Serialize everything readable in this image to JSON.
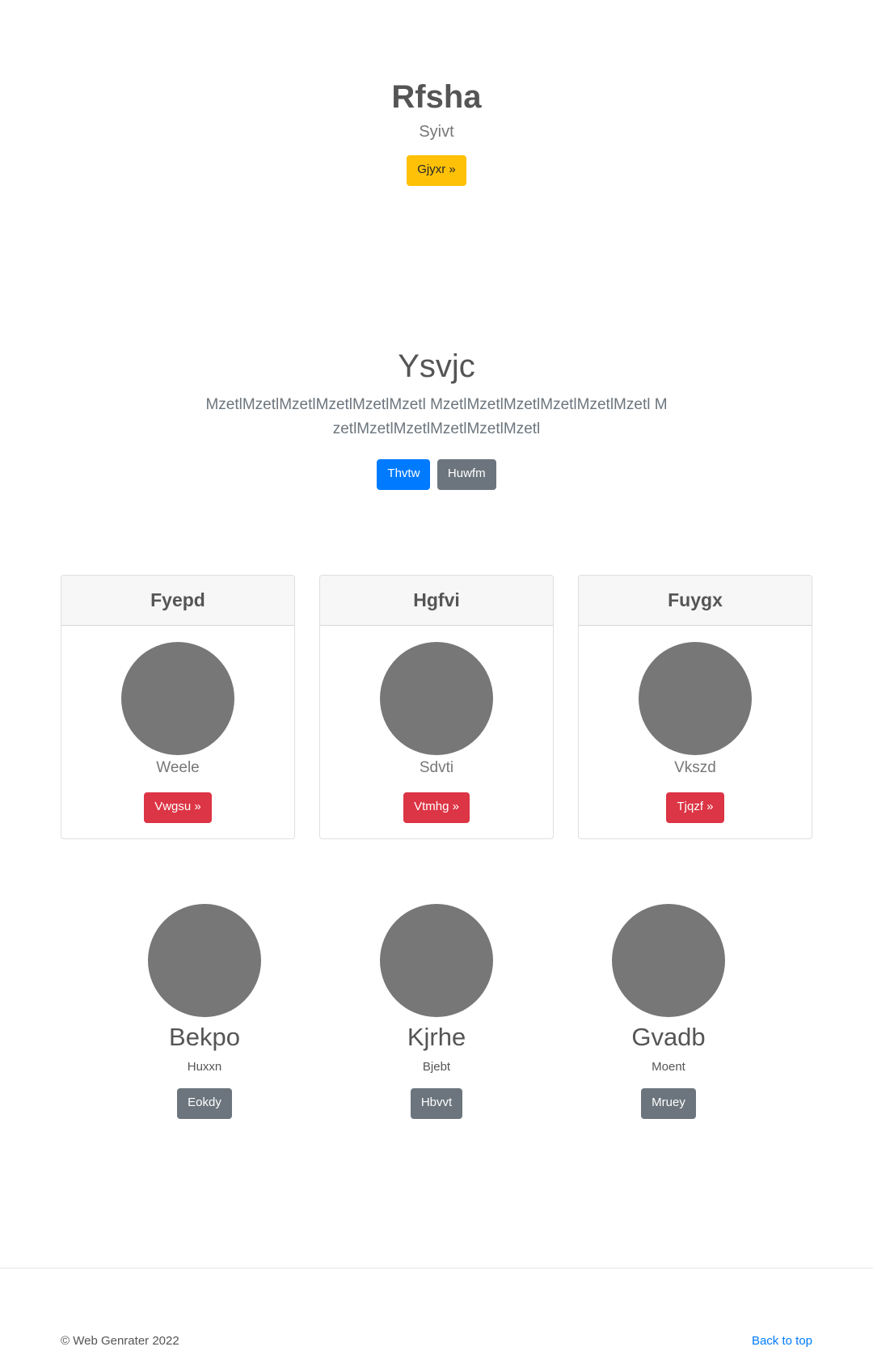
{
  "hero": {
    "title": "Rfsha",
    "subtitle": "Syivt",
    "button_label": "Gjyxr »"
  },
  "section": {
    "title": "Ysvjc",
    "lead": "MzetlMzetlMzetlMzetlMzetlMzetl MzetlMzetlMzetlMzetlMzetlMzetl MzetlMzetlMzetlMzetlMzetlMzetl",
    "primary_button": "Thvtw",
    "secondary_button": "Huwfm"
  },
  "cards": [
    {
      "header": "Fyepd",
      "subtitle": "Weele",
      "button": "Vwgsu »"
    },
    {
      "header": "Hgfvi",
      "subtitle": "Sdvti",
      "button": "Vtmhg »"
    },
    {
      "header": "Fuygx",
      "subtitle": "Vkszd",
      "button": "Tjqzf »"
    }
  ],
  "team": [
    {
      "name": "Bekpo",
      "role": "Huxxn",
      "button": "Eokdy"
    },
    {
      "name": "Kjrhe",
      "role": "Bjebt",
      "button": "Hbvvt"
    },
    {
      "name": "Gvadb",
      "role": "Moent",
      "button": "Mruey"
    }
  ],
  "footer": {
    "copyright": "© Web Genrater 2022",
    "back_to_top": "Back to top"
  }
}
